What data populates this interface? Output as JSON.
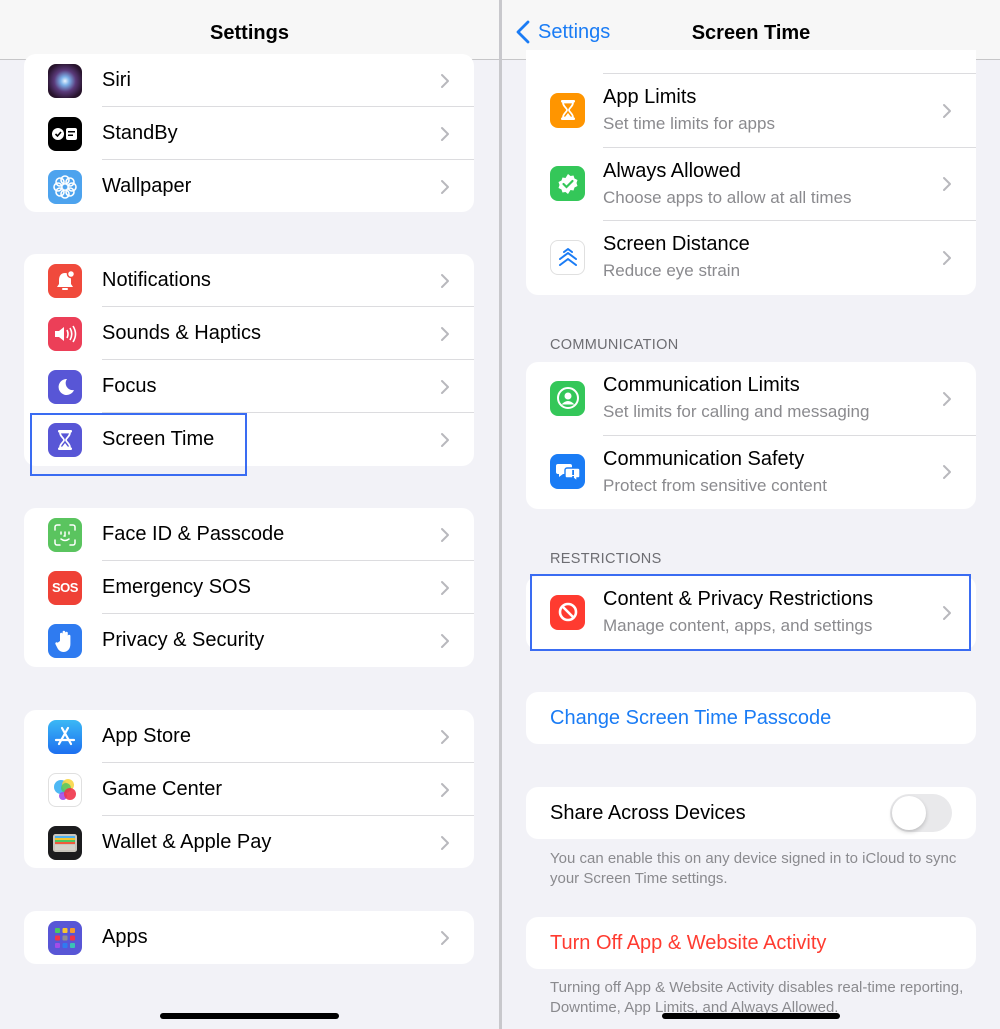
{
  "left": {
    "title": "Settings",
    "groups": [
      {
        "items": [
          {
            "label": "Siri",
            "icon": "siri-icon"
          },
          {
            "label": "StandBy",
            "icon": "standby-icon"
          },
          {
            "label": "Wallpaper",
            "icon": "wallpaper-icon"
          }
        ]
      },
      {
        "items": [
          {
            "label": "Notifications",
            "icon": "notifications-icon"
          },
          {
            "label": "Sounds & Haptics",
            "icon": "sounds-icon"
          },
          {
            "label": "Focus",
            "icon": "focus-moon-icon"
          },
          {
            "label": "Screen Time",
            "icon": "hourglass-icon"
          }
        ]
      },
      {
        "items": [
          {
            "label": "Face ID & Passcode",
            "icon": "face-id-icon"
          },
          {
            "label": "Emergency SOS",
            "icon": "sos-icon",
            "icon_text": "SOS"
          },
          {
            "label": "Privacy & Security",
            "icon": "hand-icon"
          }
        ]
      },
      {
        "items": [
          {
            "label": "App Store",
            "icon": "app-store-icon"
          },
          {
            "label": "Game Center",
            "icon": "game-center-icon"
          },
          {
            "label": "Wallet & Apple Pay",
            "icon": "wallet-icon"
          }
        ]
      },
      {
        "items": [
          {
            "label": "Apps",
            "icon": "apps-grid-icon"
          }
        ]
      }
    ],
    "highlighted_item": "Screen Time"
  },
  "right": {
    "back_label": "Settings",
    "title": "Screen Time",
    "top_group": [
      {
        "title": "App Limits",
        "subtitle": "Set time limits for apps",
        "icon": "hourglass-icon",
        "color": "#ff9500"
      },
      {
        "title": "Always Allowed",
        "subtitle": "Choose apps to allow at all times",
        "icon": "checkmark-seal-icon",
        "color": "#34c759"
      },
      {
        "title": "Screen Distance",
        "subtitle": "Reduce eye strain",
        "icon": "chevrons-up-icon",
        "color": "#ffffff"
      }
    ],
    "communication_header": "COMMUNICATION",
    "communication_group": [
      {
        "title": "Communication Limits",
        "subtitle": "Set limits for calling and messaging",
        "icon": "person-circle-icon",
        "color": "#34c759"
      },
      {
        "title": "Communication Safety",
        "subtitle": "Protect from sensitive content",
        "icon": "chat-bubble-warning-icon",
        "color": "#1a7cf5"
      }
    ],
    "restrictions_header": "RESTRICTIONS",
    "restrictions_item": {
      "title": "Content & Privacy Restrictions",
      "subtitle": "Manage content, apps, and settings",
      "icon": "prohibited-icon",
      "color": "#ff3b30"
    },
    "change_passcode_label": "Change Screen Time Passcode",
    "share_label": "Share Across Devices",
    "share_enabled": false,
    "share_footnote": "You can enable this on any device signed in to iCloud to sync your Screen Time settings.",
    "turn_off_label": "Turn Off App & Website Activity",
    "turn_off_footnote": "Turning off App & Website Activity disables real-time reporting, Downtime, App Limits, and Always Allowed."
  },
  "colors": {
    "accent_blue": "#1a7cf5",
    "destructive_red": "#ff3b30",
    "highlight_box": "#3a6cf2",
    "background": "#f2f2f7"
  }
}
